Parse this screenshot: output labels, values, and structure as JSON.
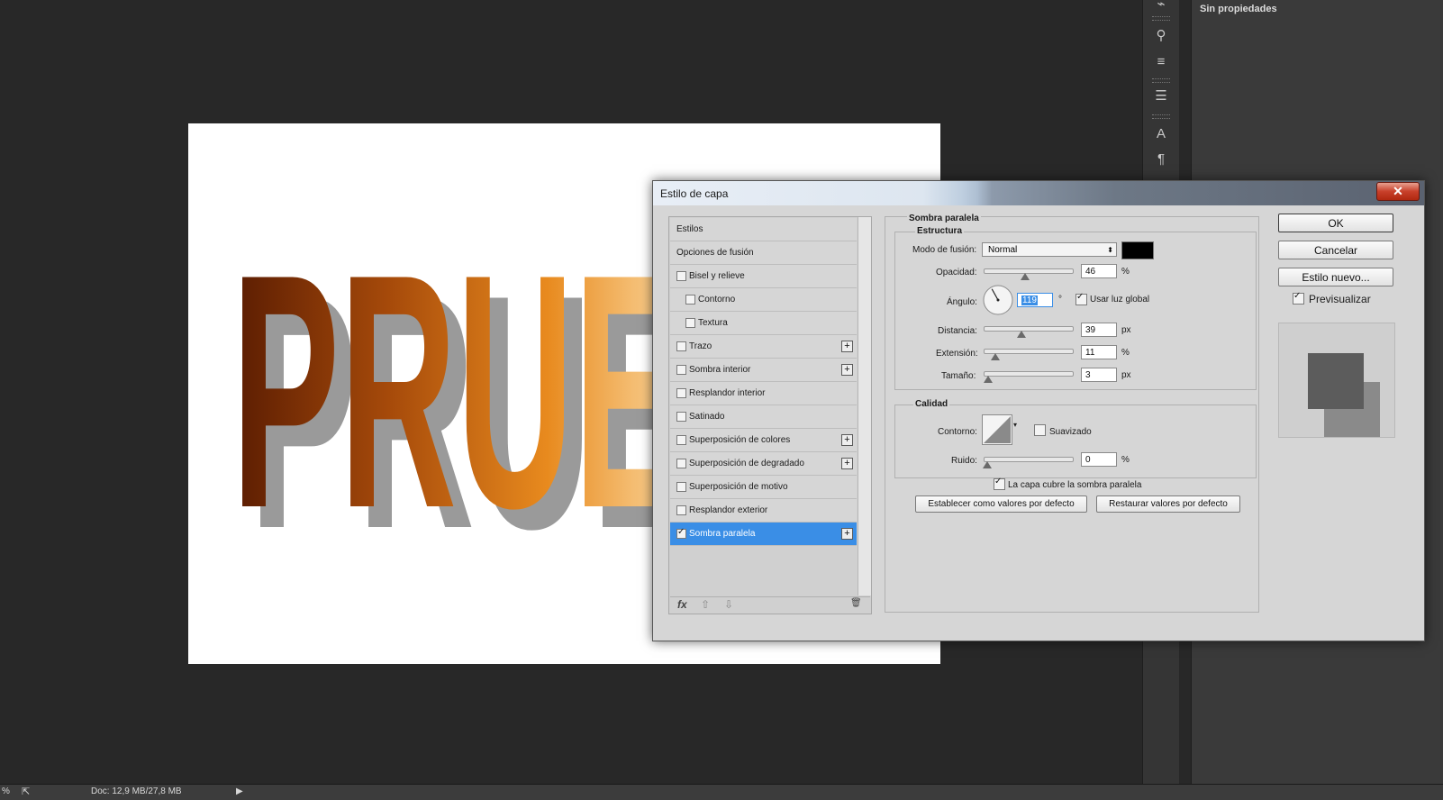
{
  "right_panel": {
    "title": "Sin propiedades"
  },
  "statusbar": {
    "zoom": "%",
    "doc": "Doc: 12,9 MB/27,8 MB"
  },
  "canvas_text": "PRUE",
  "dialog": {
    "title": "Estilo de capa",
    "close": "✕",
    "styles": [
      {
        "label": "Estilos",
        "has_checkbox": false,
        "checked": false,
        "has_plus": false,
        "indent": false
      },
      {
        "label": "Opciones de fusión",
        "has_checkbox": false,
        "checked": false,
        "has_plus": false,
        "indent": false
      },
      {
        "label": "Bisel y relieve",
        "has_checkbox": true,
        "checked": false,
        "has_plus": false,
        "indent": false
      },
      {
        "label": "Contorno",
        "has_checkbox": true,
        "checked": false,
        "has_plus": false,
        "indent": true
      },
      {
        "label": "Textura",
        "has_checkbox": true,
        "checked": false,
        "has_plus": false,
        "indent": true
      },
      {
        "label": "Trazo",
        "has_checkbox": true,
        "checked": false,
        "has_plus": true,
        "indent": false
      },
      {
        "label": "Sombra interior",
        "has_checkbox": true,
        "checked": false,
        "has_plus": true,
        "indent": false
      },
      {
        "label": "Resplandor interior",
        "has_checkbox": true,
        "checked": false,
        "has_plus": false,
        "indent": false
      },
      {
        "label": "Satinado",
        "has_checkbox": true,
        "checked": false,
        "has_plus": false,
        "indent": false
      },
      {
        "label": "Superposición de colores",
        "has_checkbox": true,
        "checked": false,
        "has_plus": true,
        "indent": false
      },
      {
        "label": "Superposición de degradado",
        "has_checkbox": true,
        "checked": false,
        "has_plus": true,
        "indent": false
      },
      {
        "label": "Superposición de motivo",
        "has_checkbox": true,
        "checked": false,
        "has_plus": false,
        "indent": false
      },
      {
        "label": "Resplandor exterior",
        "has_checkbox": true,
        "checked": false,
        "has_plus": false,
        "indent": false
      },
      {
        "label": "Sombra paralela",
        "has_checkbox": true,
        "checked": true,
        "has_plus": true,
        "indent": false,
        "selected": true
      }
    ],
    "footer": {
      "fx": "fx",
      "up": "⇧",
      "down": "⇩",
      "trash": "🗑"
    },
    "section_title": "Sombra paralela",
    "estructura": {
      "title": "Estructura",
      "blend_mode_label": "Modo de fusión:",
      "blend_mode_value": "Normal",
      "shadow_color": "#000000",
      "opacity_label": "Opacidad:",
      "opacity_value": "46",
      "opacity_unit": "%",
      "opacity_level": 0.46,
      "angle_label": "Ángulo:",
      "angle_value": "119",
      "angle_unit": "°",
      "global_light_label": "Usar luz global",
      "global_light_checked": true,
      "distance_label": "Distancia:",
      "distance_value": "39",
      "distance_unit": "px",
      "spread_label": "Extensión:",
      "spread_value": "11",
      "spread_unit": "%",
      "size_label": "Tamaño:",
      "size_value": "3",
      "size_unit": "px"
    },
    "calidad": {
      "title": "Calidad",
      "contour_label": "Contorno:",
      "antialias_label": "Suavizado",
      "antialias_checked": false,
      "noise_label": "Ruido:",
      "noise_value": "0",
      "noise_unit": "%"
    },
    "knockout_label": "La capa cubre la sombra paralela",
    "knockout_checked": true,
    "set_default_label": "Establecer como valores por defecto",
    "reset_default_label": "Restaurar valores por defecto",
    "ok_label": "OK",
    "cancel_label": "Cancelar",
    "new_style_label": "Estilo nuevo...",
    "preview_label": "Previsualizar",
    "preview_checked": true
  }
}
